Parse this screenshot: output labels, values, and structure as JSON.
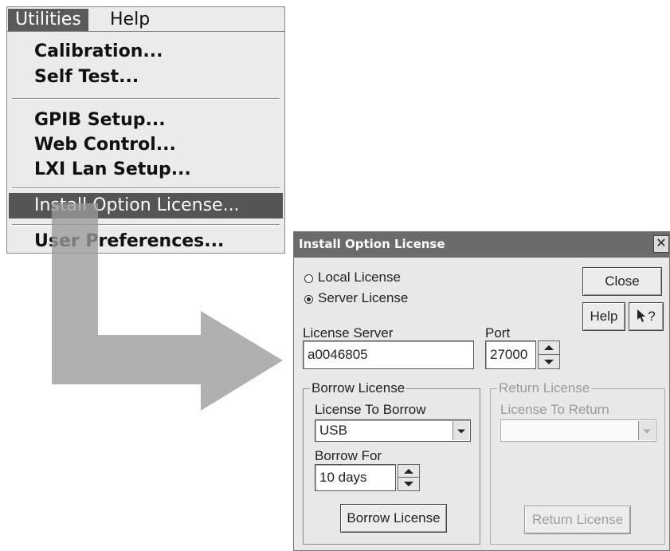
{
  "menu": {
    "bar": {
      "utilities": "Utilities",
      "help": "Help"
    },
    "items": {
      "calibration": "Calibration...",
      "self_test": "Self Test...",
      "gpib_setup": "GPIB Setup...",
      "web_control": "Web Control...",
      "lxi_lan_setup": "LXI Lan Setup...",
      "install_option_license": "Install Option License...",
      "user_preferences": "User Preferences..."
    }
  },
  "dialog": {
    "title": "Install Option License",
    "close_glyph": "✕",
    "radios": {
      "local": "Local License",
      "server": "Server License",
      "selected": "server"
    },
    "buttons": {
      "close": "Close",
      "help": "Help",
      "whats_this": "?"
    },
    "license_server": {
      "label": "License Server",
      "value": "a0046805"
    },
    "port": {
      "label": "Port",
      "value": "27000"
    },
    "borrow_group": {
      "legend": "Borrow License",
      "license_to_borrow_label": "License To Borrow",
      "license_to_borrow_value": "USB",
      "borrow_for_label": "Borrow For",
      "borrow_for_value": "10 days",
      "button": "Borrow License"
    },
    "return_group": {
      "legend": "Return License",
      "license_to_return_label": "License To Return",
      "license_to_return_value": "",
      "button": "Return License"
    }
  }
}
